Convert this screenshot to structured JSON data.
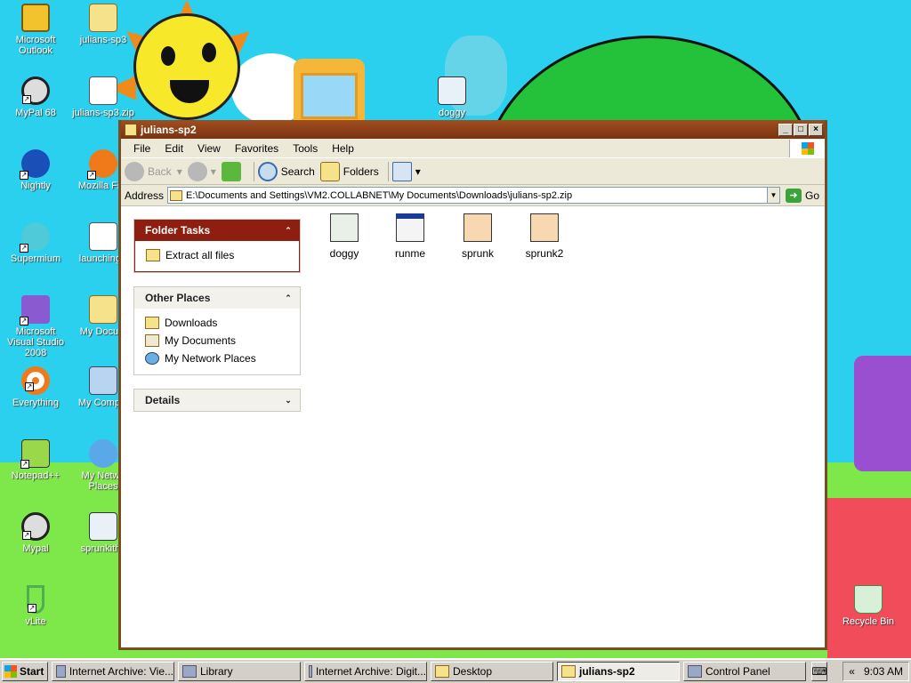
{
  "desktop_icons": [
    {
      "label": "Microsoft Outlook",
      "icon": "outlook-icon"
    },
    {
      "label": "julians-sp3",
      "icon": "zip-folder-icon"
    },
    {
      "label": "MyPal 68",
      "icon": "raccoon-icon"
    },
    {
      "label": "julians-sp3.zip",
      "icon": "zip-file-icon"
    },
    {
      "label": "doggy",
      "icon": "image-file-icon"
    },
    {
      "label": "Nightly",
      "icon": "nightly-icon"
    },
    {
      "label": "Mozilla Fire",
      "icon": "firefox-icon"
    },
    {
      "label": "Supermium",
      "icon": "supermium-icon"
    },
    {
      "label": "launching-r",
      "icon": "document-icon"
    },
    {
      "label": "Microsoft Visual Studio 2008",
      "icon": "visual-studio-icon"
    },
    {
      "label": "My Docum",
      "icon": "my-documents-icon"
    },
    {
      "label": "Everything",
      "icon": "everything-icon"
    },
    {
      "label": "My Comput",
      "icon": "my-computer-icon"
    },
    {
      "label": "Notepad++",
      "icon": "notepad-icon"
    },
    {
      "label": "My Netwo Places",
      "icon": "network-icon"
    },
    {
      "label": "Mypal",
      "icon": "raccoon-icon"
    },
    {
      "label": "sprunkithe",
      "icon": "image-file-icon"
    },
    {
      "label": "vLite",
      "icon": "vlite-icon"
    },
    {
      "label": "Recycle Bin",
      "icon": "recycle-bin-icon"
    }
  ],
  "window": {
    "title": "julians-sp2",
    "menus": [
      "File",
      "Edit",
      "View",
      "Favorites",
      "Tools",
      "Help"
    ],
    "toolbar": {
      "back": "Back",
      "search": "Search",
      "folders": "Folders"
    },
    "address_label": "Address",
    "address_value": "E:\\Documents and Settings\\VM2.COLLABNET\\My Documents\\Downloads\\julians-sp2.zip",
    "go_label": "Go"
  },
  "task_pane": {
    "folder_tasks": {
      "title": "Folder Tasks",
      "items": [
        "Extract all files"
      ]
    },
    "other_places": {
      "title": "Other Places",
      "items": [
        "Downloads",
        "My Documents",
        "My Network Places"
      ]
    },
    "details": {
      "title": "Details"
    }
  },
  "files": [
    {
      "name": "doggy",
      "icon": "image-file-icon"
    },
    {
      "name": "runme",
      "icon": "exe-icon"
    },
    {
      "name": "sprunk",
      "icon": "image-file-icon"
    },
    {
      "name": "sprunk2",
      "icon": "image-file-icon"
    }
  ],
  "taskbar": {
    "start": "Start",
    "buttons": [
      "Internet Archive: Vie...",
      "Library",
      "Internet Archive: Digit...",
      "Desktop",
      "julians-sp2",
      "Control Panel"
    ],
    "clock": "9:03 AM",
    "tray_chevron": "«"
  }
}
